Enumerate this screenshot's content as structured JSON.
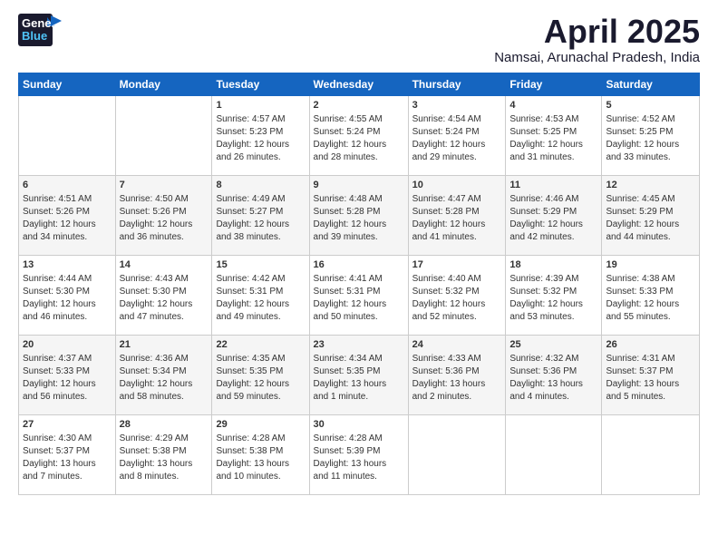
{
  "logo": {
    "general": "General",
    "blue": "Blue"
  },
  "title": "April 2025",
  "location": "Namsai, Arunachal Pradesh, India",
  "days_header": [
    "Sunday",
    "Monday",
    "Tuesday",
    "Wednesday",
    "Thursday",
    "Friday",
    "Saturday"
  ],
  "weeks": [
    [
      {
        "day": "",
        "content": ""
      },
      {
        "day": "",
        "content": ""
      },
      {
        "day": "1",
        "content": "Sunrise: 4:57 AM\nSunset: 5:23 PM\nDaylight: 12 hours and 26 minutes."
      },
      {
        "day": "2",
        "content": "Sunrise: 4:55 AM\nSunset: 5:24 PM\nDaylight: 12 hours and 28 minutes."
      },
      {
        "day": "3",
        "content": "Sunrise: 4:54 AM\nSunset: 5:24 PM\nDaylight: 12 hours and 29 minutes."
      },
      {
        "day": "4",
        "content": "Sunrise: 4:53 AM\nSunset: 5:25 PM\nDaylight: 12 hours and 31 minutes."
      },
      {
        "day": "5",
        "content": "Sunrise: 4:52 AM\nSunset: 5:25 PM\nDaylight: 12 hours and 33 minutes."
      }
    ],
    [
      {
        "day": "6",
        "content": "Sunrise: 4:51 AM\nSunset: 5:26 PM\nDaylight: 12 hours and 34 minutes."
      },
      {
        "day": "7",
        "content": "Sunrise: 4:50 AM\nSunset: 5:26 PM\nDaylight: 12 hours and 36 minutes."
      },
      {
        "day": "8",
        "content": "Sunrise: 4:49 AM\nSunset: 5:27 PM\nDaylight: 12 hours and 38 minutes."
      },
      {
        "day": "9",
        "content": "Sunrise: 4:48 AM\nSunset: 5:28 PM\nDaylight: 12 hours and 39 minutes."
      },
      {
        "day": "10",
        "content": "Sunrise: 4:47 AM\nSunset: 5:28 PM\nDaylight: 12 hours and 41 minutes."
      },
      {
        "day": "11",
        "content": "Sunrise: 4:46 AM\nSunset: 5:29 PM\nDaylight: 12 hours and 42 minutes."
      },
      {
        "day": "12",
        "content": "Sunrise: 4:45 AM\nSunset: 5:29 PM\nDaylight: 12 hours and 44 minutes."
      }
    ],
    [
      {
        "day": "13",
        "content": "Sunrise: 4:44 AM\nSunset: 5:30 PM\nDaylight: 12 hours and 46 minutes."
      },
      {
        "day": "14",
        "content": "Sunrise: 4:43 AM\nSunset: 5:30 PM\nDaylight: 12 hours and 47 minutes."
      },
      {
        "day": "15",
        "content": "Sunrise: 4:42 AM\nSunset: 5:31 PM\nDaylight: 12 hours and 49 minutes."
      },
      {
        "day": "16",
        "content": "Sunrise: 4:41 AM\nSunset: 5:31 PM\nDaylight: 12 hours and 50 minutes."
      },
      {
        "day": "17",
        "content": "Sunrise: 4:40 AM\nSunset: 5:32 PM\nDaylight: 12 hours and 52 minutes."
      },
      {
        "day": "18",
        "content": "Sunrise: 4:39 AM\nSunset: 5:32 PM\nDaylight: 12 hours and 53 minutes."
      },
      {
        "day": "19",
        "content": "Sunrise: 4:38 AM\nSunset: 5:33 PM\nDaylight: 12 hours and 55 minutes."
      }
    ],
    [
      {
        "day": "20",
        "content": "Sunrise: 4:37 AM\nSunset: 5:33 PM\nDaylight: 12 hours and 56 minutes."
      },
      {
        "day": "21",
        "content": "Sunrise: 4:36 AM\nSunset: 5:34 PM\nDaylight: 12 hours and 58 minutes."
      },
      {
        "day": "22",
        "content": "Sunrise: 4:35 AM\nSunset: 5:35 PM\nDaylight: 12 hours and 59 minutes."
      },
      {
        "day": "23",
        "content": "Sunrise: 4:34 AM\nSunset: 5:35 PM\nDaylight: 13 hours and 1 minute."
      },
      {
        "day": "24",
        "content": "Sunrise: 4:33 AM\nSunset: 5:36 PM\nDaylight: 13 hours and 2 minutes."
      },
      {
        "day": "25",
        "content": "Sunrise: 4:32 AM\nSunset: 5:36 PM\nDaylight: 13 hours and 4 minutes."
      },
      {
        "day": "26",
        "content": "Sunrise: 4:31 AM\nSunset: 5:37 PM\nDaylight: 13 hours and 5 minutes."
      }
    ],
    [
      {
        "day": "27",
        "content": "Sunrise: 4:30 AM\nSunset: 5:37 PM\nDaylight: 13 hours and 7 minutes."
      },
      {
        "day": "28",
        "content": "Sunrise: 4:29 AM\nSunset: 5:38 PM\nDaylight: 13 hours and 8 minutes."
      },
      {
        "day": "29",
        "content": "Sunrise: 4:28 AM\nSunset: 5:38 PM\nDaylight: 13 hours and 10 minutes."
      },
      {
        "day": "30",
        "content": "Sunrise: 4:28 AM\nSunset: 5:39 PM\nDaylight: 13 hours and 11 minutes."
      },
      {
        "day": "",
        "content": ""
      },
      {
        "day": "",
        "content": ""
      },
      {
        "day": "",
        "content": ""
      }
    ]
  ]
}
